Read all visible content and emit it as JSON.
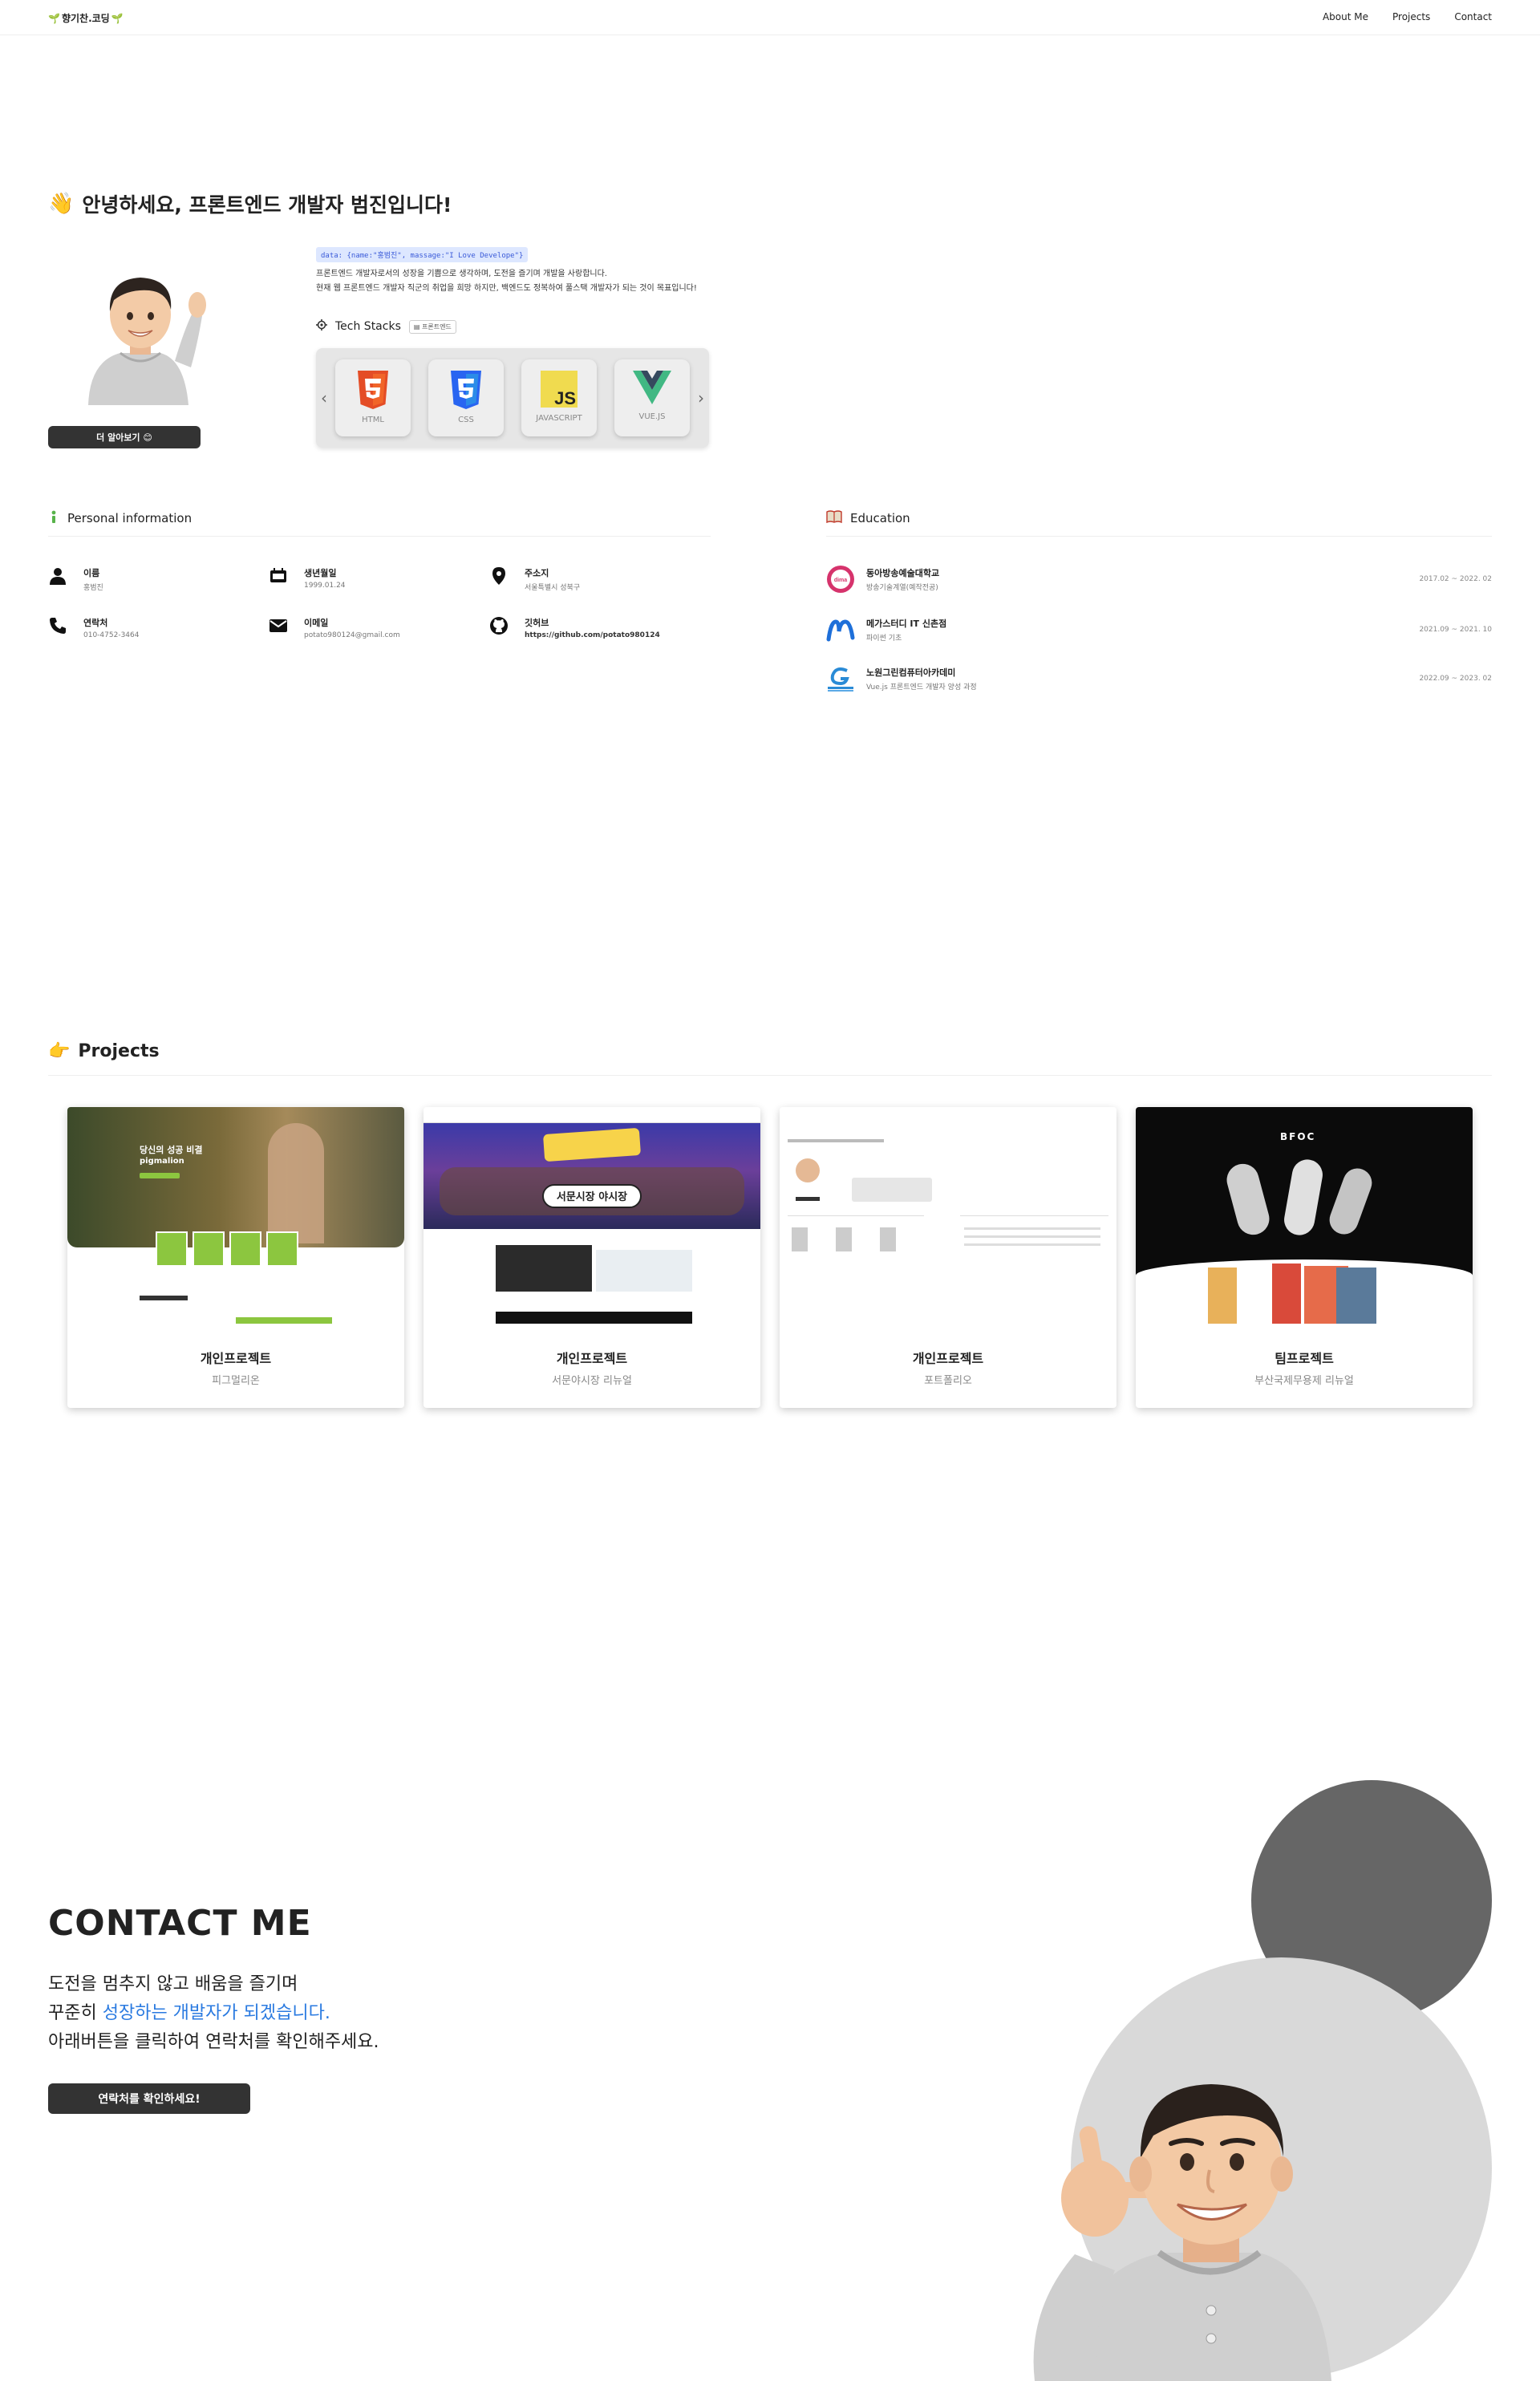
{
  "header": {
    "logo_text": "향기찬.코딩",
    "nav": [
      "About Me",
      "Projects",
      "Contact"
    ]
  },
  "hero": {
    "title": "안녕하세요, 프론트엔드 개발자 범진입니다!",
    "more_button": "더 알아보기",
    "code": "data: {name:\"홍범진\", massage:\"I Love Develope\"}",
    "intro_1": "프론트엔드 개발자로서의 성장을 기쁨으로 생각하며, 도전을 즐기며 개발을 사랑합니다.",
    "intro_2": "현재 웹 프론트엔드 개발자 직군의 취업을 희망 하지만, 백엔드도 정복하여 풀스택 개발자가 되는 것이 목표입니다!",
    "stack_title": "Tech Stacks",
    "stack_badge": "프론트엔드",
    "stacks": [
      {
        "label": "HTML",
        "color": "#e44d26"
      },
      {
        "label": "CSS",
        "color": "#2965f1"
      },
      {
        "label": "JAVASCRIPT",
        "color": "#f0db4f"
      },
      {
        "label": "VUE.JS",
        "color": "#41b883"
      }
    ]
  },
  "personal": {
    "title": "Personal information",
    "items": [
      {
        "label": "이름",
        "value": "홍범진",
        "icon": "person-icon"
      },
      {
        "label": "생년월일",
        "value": "1999.01.24",
        "icon": "calendar-icon"
      },
      {
        "label": "주소지",
        "value": "서울특별시 성북구",
        "icon": "location-icon"
      },
      {
        "label": "연락처",
        "value": "010-4752-3464",
        "icon": "phone-icon"
      },
      {
        "label": "이메일",
        "value": "potato980124@gmail.com",
        "icon": "mail-icon"
      },
      {
        "label": "깃허브",
        "value": "https://github.com/potato980124",
        "icon": "github-icon"
      }
    ]
  },
  "education": {
    "title": "Education",
    "items": [
      {
        "name": "동아방송예술대학교",
        "desc": "방송기술계열(예작전공)",
        "date": "2017.02 ~ 2022. 02",
        "color": "#d6336c"
      },
      {
        "name": "메가스터디 IT 신촌점",
        "desc": "파이썬 기초",
        "date": "2021.09 ~ 2021. 10",
        "color": "#1e6fd9"
      },
      {
        "name": "노원그린컴퓨터아카데미",
        "desc": "Vue.js 프론트엔드 개발자 양성 과정",
        "date": "2022.09 ~ 2023. 02",
        "color": "#2a8bd6"
      }
    ]
  },
  "projects": {
    "title": "Projects",
    "items": [
      {
        "type": "개인프로젝트",
        "name": "피그멀리온"
      },
      {
        "type": "개인프로젝트",
        "name": "서문야시장 리뉴얼"
      },
      {
        "type": "개인프로젝트",
        "name": "포트폴리오"
      },
      {
        "type": "팀프로젝트",
        "name": "부산국제무용제 리뉴얼"
      }
    ],
    "thumb1": {
      "headline": "당신의 성공 비결",
      "brand": "pigmalion"
    },
    "thumb2": {
      "banner": "서문시장 야시장"
    },
    "thumb4": {
      "brand": "BFOC"
    }
  },
  "contact": {
    "heading": "CONTACT ME",
    "line1": "도전을 멈추지 않고 배움을 즐기며",
    "line2_prefix": "꾸준히 ",
    "line2_highlight": "성장하는 개발자가 되겠습니다.",
    "line3": "아래버튼을 클릭하여 연락처를 확인해주세요.",
    "button": "연락처를 확인하세요!"
  }
}
